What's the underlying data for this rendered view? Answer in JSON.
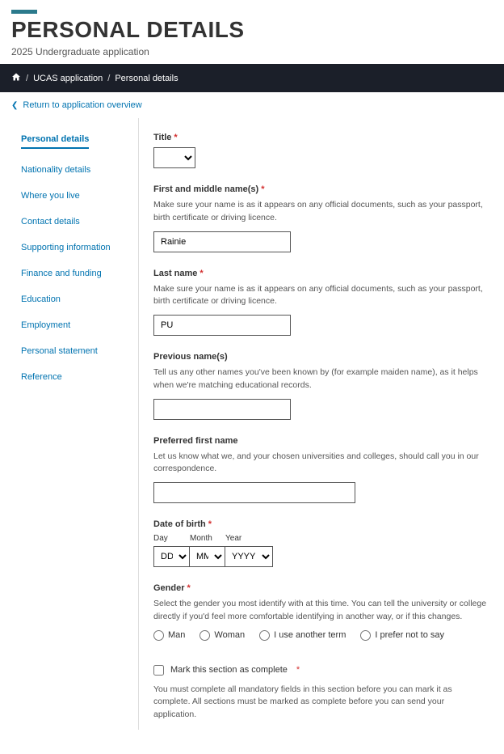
{
  "header": {
    "title": "PERSONAL DETAILS",
    "subtitle": "2025 Undergraduate application"
  },
  "breadcrumb": {
    "item1": "UCAS application",
    "item2": "Personal details"
  },
  "backlink": "Return to application overview",
  "sidebar": {
    "items": [
      "Personal details",
      "Nationality details",
      "Where you live",
      "Contact details",
      "Supporting information",
      "Finance and funding",
      "Education",
      "Employment",
      "Personal statement",
      "Reference"
    ]
  },
  "form": {
    "title": {
      "label": "Title"
    },
    "first_name": {
      "label": "First and middle name(s)",
      "hint": "Make sure your name is as it appears on any official documents, such as your passport, birth certificate or driving licence.",
      "value": "Rainie"
    },
    "last_name": {
      "label": "Last name",
      "hint": "Make sure your name is as it appears on any official documents, such as your passport, birth certificate or driving licence.",
      "value": "PU"
    },
    "previous_name": {
      "label": "Previous name(s)",
      "hint": "Tell us any other names you've been known by (for example maiden name), as it helps when we're matching educational records.",
      "value": ""
    },
    "preferred_name": {
      "label": "Preferred first name",
      "hint": "Let us know what we, and your chosen universities and colleges, should call you in our correspondence.",
      "value": ""
    },
    "dob": {
      "label": "Date of birth",
      "day_label": "Day",
      "month_label": "Month",
      "year_label": "Year",
      "day_ph": "DD",
      "month_ph": "MM",
      "year_ph": "YYYY"
    },
    "gender": {
      "label": "Gender",
      "hint": "Select the gender you most identify with at this time. You can tell the university or college directly if you'd feel more comfortable identifying in another way, or if this changes.",
      "options": [
        "Man",
        "Woman",
        "I use another term",
        "I prefer not to say"
      ]
    },
    "complete": {
      "label": "Mark this section as complete",
      "hint": "You must complete all mandatory fields in this section before you can mark it as complete. All sections must be marked as complete before you can send your application."
    }
  }
}
